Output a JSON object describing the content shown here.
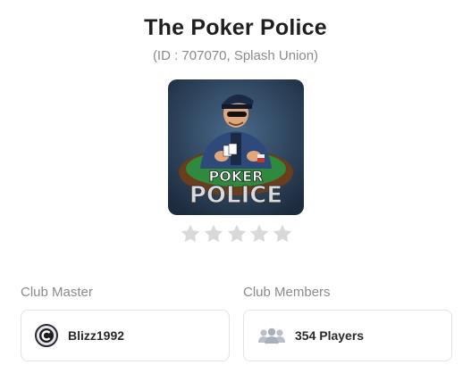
{
  "club": {
    "name": "The Poker Police",
    "meta": "(ID : 707070, Splash Union)",
    "logo_icon": "poker-police-logo",
    "logo_text_top": "POKER",
    "logo_text_bottom": "POLICE",
    "rating": {
      "value": 0,
      "max": 5
    }
  },
  "master": {
    "label": "Club Master",
    "name": "Blizz1992",
    "avatar_icon": "avatar-icon"
  },
  "members": {
    "label": "Club Members",
    "count_text": "354 Players",
    "icon": "users-icon"
  },
  "colors": {
    "title": "#1f1f1f",
    "muted": "#8a8a8a",
    "star_empty": "#d9d9d9",
    "card_border": "#e3e3e3"
  }
}
